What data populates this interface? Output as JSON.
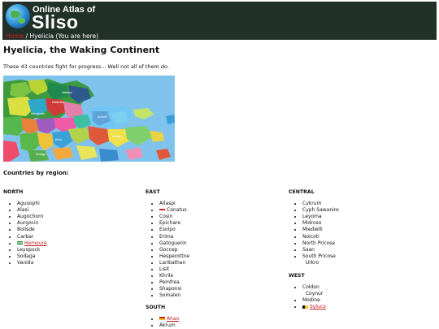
{
  "site": {
    "subtitle": "Online Atlas of",
    "title": "Sliso"
  },
  "breadcrumb": {
    "home": "Home",
    "separator": "/",
    "current": "Hyelicia (You are here)"
  },
  "page": {
    "title": "Hyelicia, the Waking Continent",
    "intro": "These 43 countries fight for progress... Well not all of them do.",
    "regions_heading": "Countries by region:"
  },
  "map_labels": [
    "Nalwaru",
    "Hemstrade",
    "Mistaraka",
    "Aulandi",
    "Eriha",
    "Dolaga",
    "Sodaga"
  ],
  "regions": {
    "north": {
      "title": "NORTH",
      "countries": [
        "Agusophi",
        "Alasi",
        "Augochoro",
        "Aurgocin",
        "Bolisde",
        "Carbar",
        "Hemoure",
        "Leyopock",
        "Sodaga",
        "Vanida"
      ]
    },
    "east": {
      "title": "EAST",
      "countries": [
        "Allaspi",
        "Conatus",
        "Cosin",
        "Epichare",
        "Esolpo",
        "Erima",
        "Gatoguerin",
        "Goccep",
        "Hesperottne",
        "Laribathan",
        "Lisit",
        "Khrile",
        "Pemfrea",
        "Shaponsi",
        "Somalen"
      ]
    },
    "south": {
      "title": "SOUTH",
      "countries": [
        "Ahao",
        "Akrum"
      ]
    },
    "central": {
      "title": "CENTRAL",
      "countries": [
        "Cykrum",
        "Cyph Sawanire",
        "Leyoma",
        "Midroso",
        "Miedielli",
        "Nolcoti",
        "North Pricose",
        "Saan",
        "South Pricose",
        "Urkro"
      ]
    },
    "west": {
      "title": "WEST",
      "countries": [
        "Coldon",
        "Coynur",
        "Modine",
        "Syluco"
      ]
    }
  },
  "colors": {
    "header_bg": "#22302a",
    "link": "#c01818",
    "ocean": "#7fc3ec"
  }
}
